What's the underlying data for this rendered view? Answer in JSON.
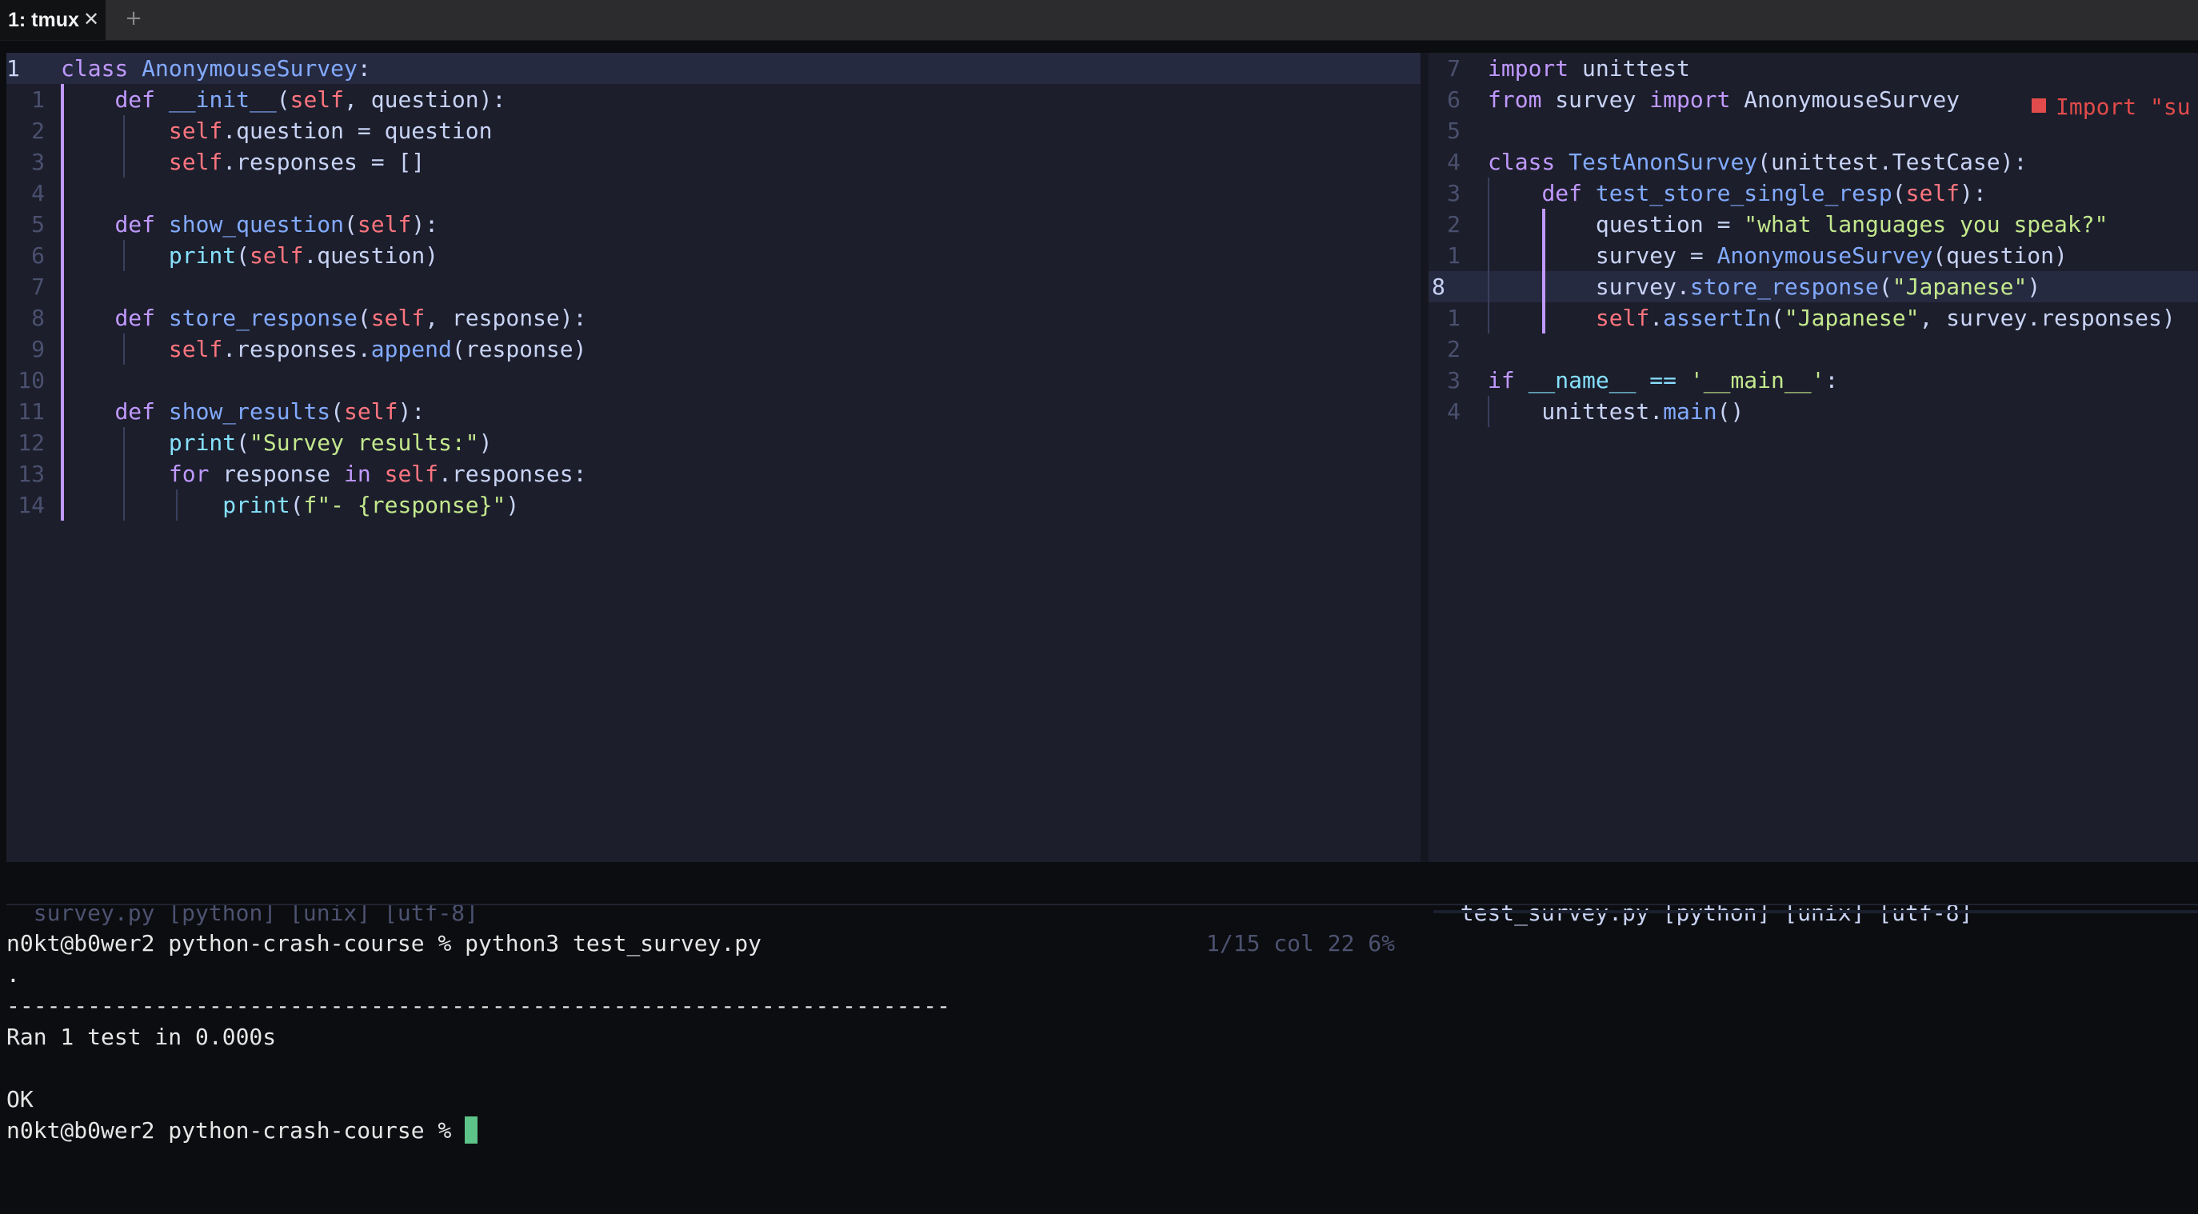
{
  "tab": {
    "title": "1: tmux",
    "close_icon": "✕",
    "new_icon": "+"
  },
  "left_editor": {
    "filename": "survey.py",
    "status": "survey.py [python] [unix] [utf-8]",
    "position": "1/15 col 22 6%",
    "line_numbers": [
      "1",
      "1",
      "2",
      "3",
      "4",
      "5",
      "6",
      "7",
      "8",
      "9",
      "10",
      "11",
      "12",
      "13",
      "14"
    ],
    "lines": [
      "class AnonymouseSurvey:",
      "    def __init__(self, question):",
      "        self.question = question",
      "        self.responses = []",
      "",
      "    def show_question(self):",
      "        print(self.question)",
      "",
      "    def store_response(self, response):",
      "        self.responses.append(response)",
      "",
      "    def show_results(self):",
      "        print(\"Survey results:\")",
      "        for response in self.responses:",
      "            print(f\"- {response}\")"
    ]
  },
  "right_editor": {
    "filename": "test_survey.py",
    "status": "test_survey.py [python] [unix] [utf-8]",
    "line_numbers": [
      "7",
      "6",
      "5",
      "4",
      "3",
      "2",
      "1",
      "8",
      "1",
      "2",
      "3",
      "4"
    ],
    "lines": [
      "import unittest",
      "from survey import AnonymouseSurvey",
      "",
      "class TestAnonSurvey(unittest.TestCase):",
      "    def test_store_single_resp(self):",
      "        question = \"what languages you speak?\"",
      "        survey = AnonymouseSurvey(question)",
      "        survey.store_response(\"Japanese\")",
      "        self.assertIn(\"Japanese\", survey.responses)",
      "",
      "if __name__ == '__main__':",
      "    unittest.main()"
    ],
    "diagnostic": "Import \"su"
  },
  "terminal": {
    "lines": [
      "n0kt@b0wer2 python-crash-course % python3 test_survey.py",
      ".",
      "----------------------------------------------------------------------",
      "Ran 1 test in 0.000s",
      "",
      "OK"
    ],
    "prompt": "n0kt@b0wer2 python-crash-course % "
  },
  "colors": {
    "editor_bg": "#1c1e2b",
    "keyword": "#c099ff",
    "function": "#82aaff",
    "string": "#c3e88d",
    "self": "#ff757f",
    "param": "#ffc777",
    "type": "#4fd6be",
    "error": "#e24b4b",
    "cursor": "#5dc389"
  }
}
